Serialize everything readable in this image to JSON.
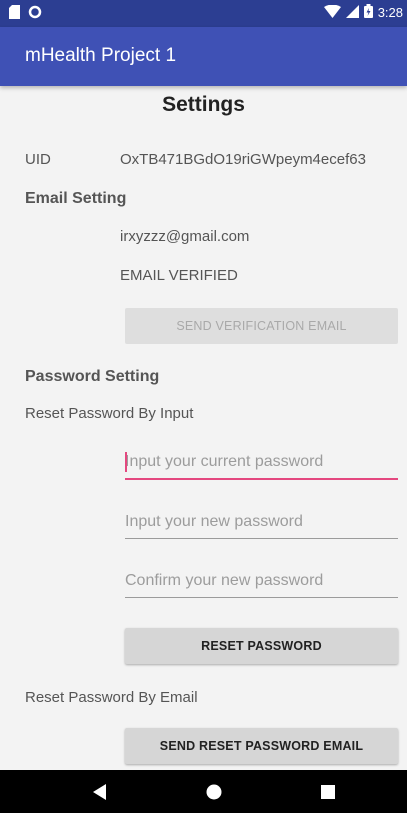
{
  "status_bar": {
    "time": "3:28",
    "icons": [
      "sim-card-icon",
      "circle-notification-icon",
      "wifi-icon",
      "signal-icon",
      "battery-icon"
    ]
  },
  "app_bar": {
    "title": "mHealth Project 1"
  },
  "settings": {
    "title": "Settings",
    "uid_label": "UID",
    "uid_value": "OxTB471BGdO19riGWpeym4ecef63",
    "email_section": "Email Setting",
    "email": "irxyzzz@gmail.com",
    "email_status": "EMAIL VERIFIED",
    "send_verification_label": "SEND VERIFICATION EMAIL",
    "password_section": "Password Setting",
    "reset_by_input_label": "Reset Password By Input",
    "current_password_placeholder": "Input your current password",
    "new_password_placeholder": "Input your new password",
    "confirm_password_placeholder": "Confirm your new password",
    "reset_password_label": "RESET PASSWORD",
    "reset_by_email_label": "Reset Password By Email",
    "send_reset_email_label": "SEND RESET PASSWORD EMAIL"
  },
  "colors": {
    "status_bar": "#2c3e92",
    "app_bar": "#3f51b5",
    "accent": "#e4487f",
    "background": "#f3f3f3"
  }
}
